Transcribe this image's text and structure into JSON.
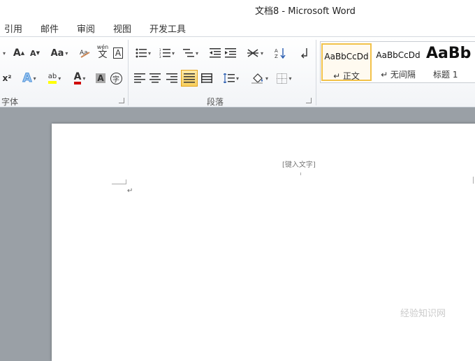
{
  "window": {
    "title": "文档8  -  Microsoft Word"
  },
  "tabs": [
    "引用",
    "邮件",
    "审阅",
    "视图",
    "开发工具"
  ],
  "font_group": {
    "label": "字体",
    "grow_font": "A",
    "shrink_font": "A",
    "change_case": "Aa",
    "phonetic": "wén",
    "phonetic_char": "文",
    "char_border": "A",
    "superscript": "x²",
    "text_effect": "A",
    "highlight": "ab",
    "font_color": "A",
    "char_shading": "A",
    "enclose_char": "字"
  },
  "paragraph_group": {
    "label": "段落"
  },
  "styles": [
    {
      "sample": "AaBbCcDd",
      "name": "↵ 正文",
      "selected": true
    },
    {
      "sample": "AaBbCcDd",
      "name": "↵ 无间隔",
      "selected": false
    },
    {
      "sample": "AaBb",
      "name": "标题 1",
      "selected": false
    }
  ],
  "document": {
    "header_placeholder": "[键入文字]",
    "para_mark": "↵"
  },
  "colors": {
    "highlight": "#ffff00",
    "font_color": "#d00000",
    "selected_border": "#f2c24a"
  },
  "watermark": "经验知识网"
}
